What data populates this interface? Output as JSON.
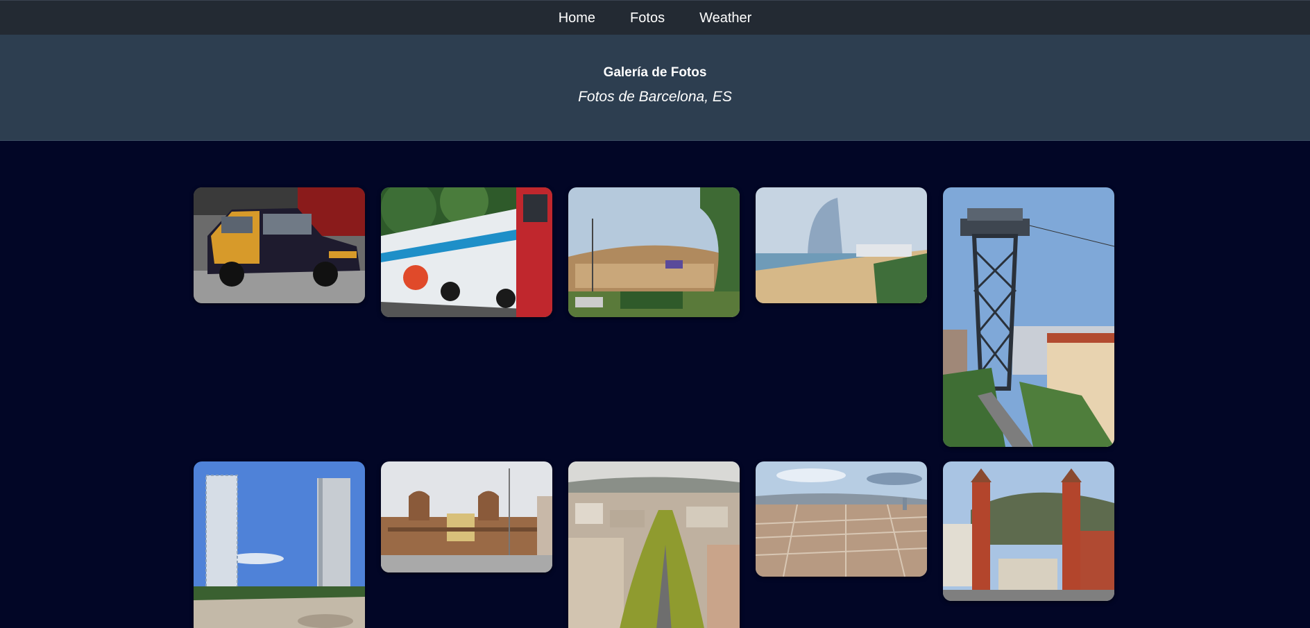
{
  "nav": {
    "items": [
      {
        "label": "Home"
      },
      {
        "label": "Fotos"
      },
      {
        "label": "Weather"
      }
    ]
  },
  "header": {
    "title": "Galería de Fotos",
    "subtitle": "Fotos de Barcelona, ES"
  },
  "colors": {
    "nav_bg": "#232a33",
    "header_bg": "#2d3e50",
    "page_bg": "#020626",
    "text": "#ffffff"
  },
  "photos": [
    {
      "subject": "taxi"
    },
    {
      "subject": "tourist-bus"
    },
    {
      "subject": "arena-building"
    },
    {
      "subject": "hotel-beach"
    },
    {
      "subject": "cable-car-tower"
    },
    {
      "subject": "twin-towers"
    },
    {
      "subject": "bullring"
    },
    {
      "subject": "city-boulevard"
    },
    {
      "subject": "city-panorama"
    },
    {
      "subject": "venetian-towers"
    }
  ]
}
